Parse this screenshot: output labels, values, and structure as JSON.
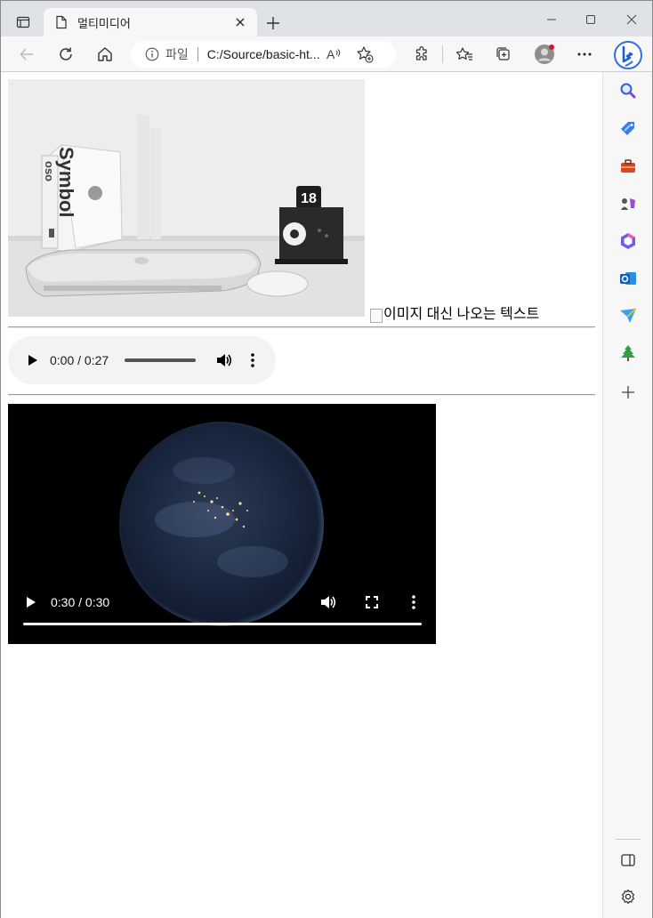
{
  "browser": {
    "tab": {
      "title": "멀티미디어",
      "favicon": "page-icon"
    },
    "new_tab_icon": "plus-icon",
    "window_controls": [
      "minimize-icon",
      "maximize-icon",
      "close-icon"
    ],
    "address_bar": {
      "scheme_label": "파일",
      "url": "C:/Source/basic-ht..."
    },
    "toolbar_icons": [
      "back-icon",
      "refresh-icon",
      "home-icon",
      "read-aloud-icon",
      "add-favorite-icon",
      "extensions-icon",
      "favorites-icon",
      "collections-icon",
      "profile-icon",
      "more-icon"
    ],
    "sidebar_icons": [
      "search-icon",
      "shopping-icon",
      "tools-icon",
      "games-icon",
      "office-icon",
      "outlook-icon",
      "send-icon",
      "tree-icon",
      "add-icon",
      "hide-sidebar-icon",
      "settings-icon"
    ],
    "colors": {
      "tabstrip": "#dfe3e8",
      "toolbar": "#f7f7f7",
      "audio_bg": "#f1f3f4",
      "profile_badge": "#e0102f"
    }
  },
  "page": {
    "image_alt_text": "이미지 대신 나오는 텍스트",
    "photo": {
      "book_title": "Symbol",
      "book_subtitle": "oso",
      "clock_number": "18"
    },
    "audio": {
      "time": "0:00 / 0:27"
    },
    "video": {
      "time": "0:30 / 0:30",
      "progress": 1.0
    }
  }
}
